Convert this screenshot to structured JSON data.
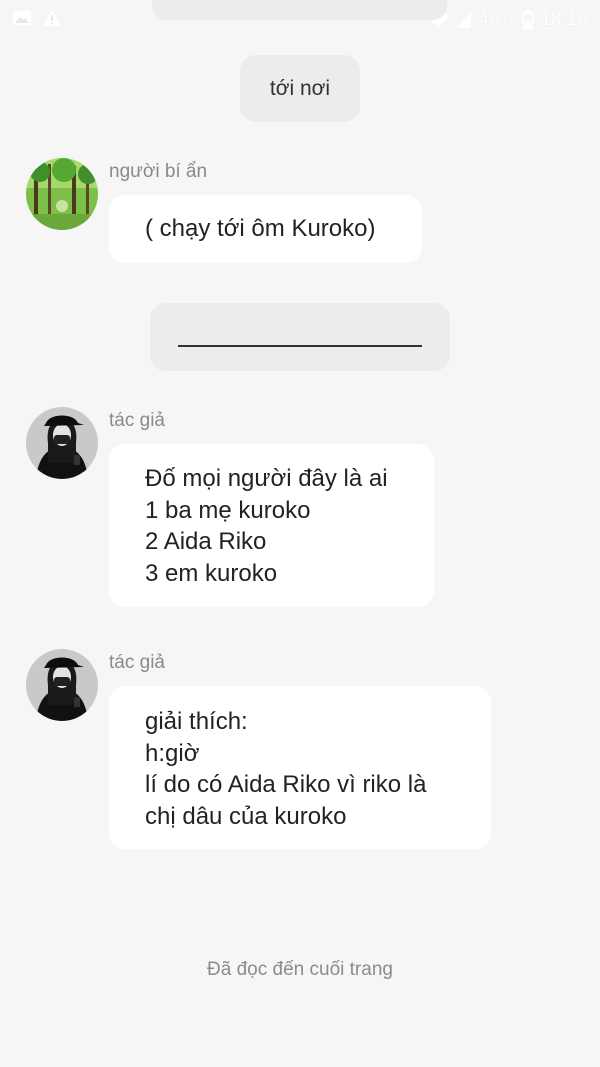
{
  "status_bar": {
    "battery_percent": "48%",
    "time": "18:16",
    "icons": [
      "gallery-icon",
      "warning-icon",
      "wifi-icon",
      "signal-icon",
      "battery-icon"
    ]
  },
  "messages": [
    {
      "type": "system",
      "text": "tới nơi"
    },
    {
      "type": "user",
      "sender": "người bí ẩn",
      "avatar": "forest-avatar",
      "lines": [
        "( chạy tới ôm Kuroko)"
      ]
    },
    {
      "type": "system-divider",
      "text": ""
    },
    {
      "type": "user",
      "sender": "tác giả",
      "avatar": "girl-cap-avatar",
      "lines": [
        "Đố mọi người đây là ai",
        "1 ba mẹ kuroko",
        "2 Aida Riko",
        "3 em kuroko"
      ]
    },
    {
      "type": "user",
      "sender": "tác giả",
      "avatar": "girl-cap-avatar",
      "lines": [
        "giải thích:",
        "h:giờ",
        "lí do có Aida Riko vì riko là",
        "chị dâu của kuroko"
      ]
    }
  ],
  "footer": {
    "end_note": "Đã đọc đến cuối trang"
  },
  "colors": {
    "background": "#f6f6f6",
    "system_bubble": "#ececec",
    "user_bubble": "#ffffff",
    "sender": "#8a8a8a"
  }
}
